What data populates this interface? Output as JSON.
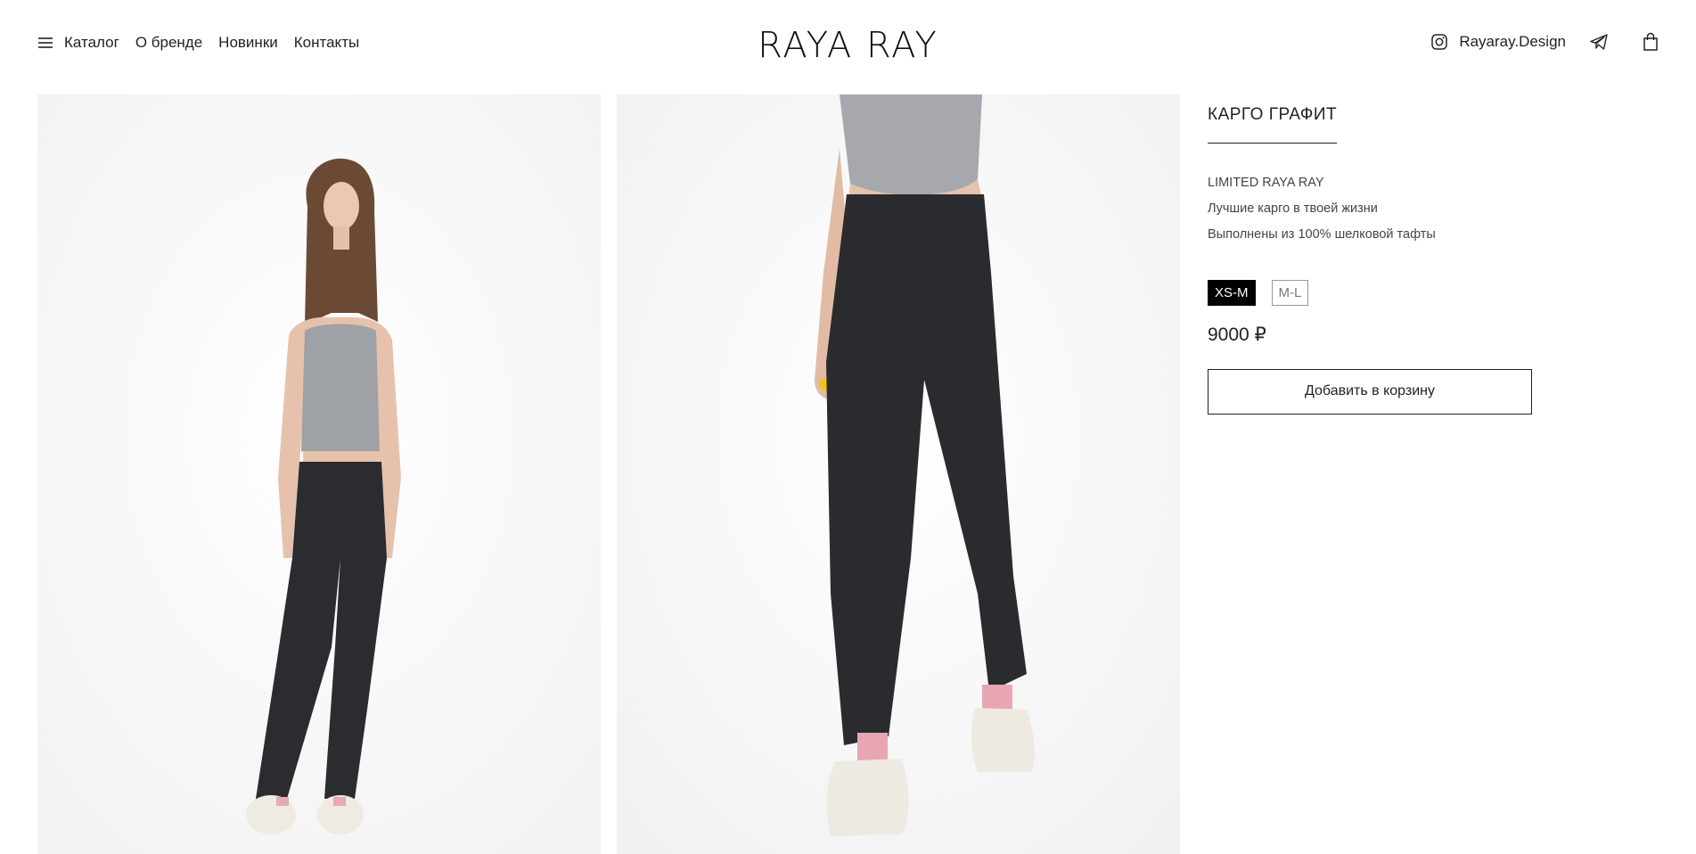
{
  "header": {
    "menu_items": [
      "Каталог",
      "О бренде",
      "Новинки",
      "Контакты"
    ],
    "logo": "RAYA RAY",
    "instagram_handle": "Rayaray.Design",
    "icons": {
      "menu": "hamburger-menu-icon",
      "instagram": "instagram-icon",
      "telegram": "telegram-icon",
      "cart": "shopping-bag-icon"
    }
  },
  "gallery": {
    "images": [
      {
        "alt": "front-view-model-photo"
      },
      {
        "alt": "back-view-model-photo"
      }
    ]
  },
  "product": {
    "title": "КАРГО ГРАФИТ",
    "description": [
      "LIMITED RAYA RAY",
      "Лучшие карго в твоей жизни",
      "Выполнены из 100% шелковой тафты"
    ],
    "sizes": [
      {
        "label": "XS-M",
        "selected": true
      },
      {
        "label": "M-L",
        "selected": false
      }
    ],
    "price": "9000 ₽",
    "add_to_cart_label": "Добавить в корзину"
  },
  "colors": {
    "text": "#222222",
    "selected_size_bg": "#000000",
    "background": "#ffffff"
  }
}
